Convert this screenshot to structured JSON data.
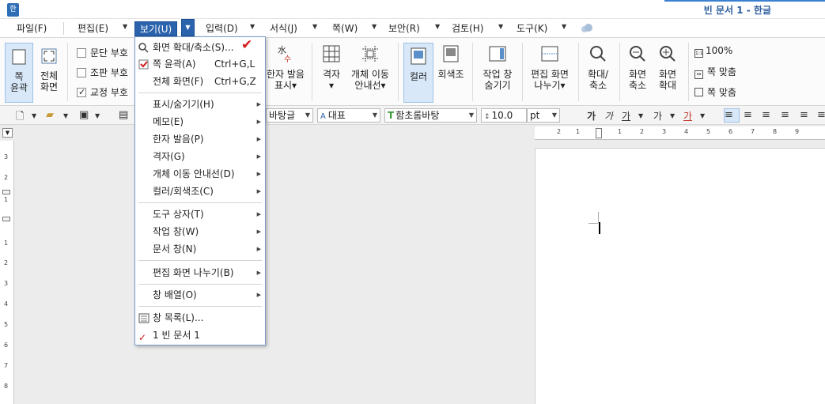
{
  "window": {
    "app_icon": "한",
    "title": "빈 문서 1 - 한글"
  },
  "menubar": {
    "items": [
      {
        "label": "파일(F)"
      },
      {
        "label": "편집(E)"
      },
      {
        "label": "보기(U)"
      },
      {
        "label": "입력(D)"
      },
      {
        "label": "서식(J)"
      },
      {
        "label": "쪽(W)"
      },
      {
        "label": "보안(R)"
      },
      {
        "label": "검토(H)"
      },
      {
        "label": "도구(K)"
      }
    ]
  },
  "ribbon": {
    "page_outline": "쪽\n윤곽",
    "full_screen": "전체\n화면",
    "checkboxes": [
      {
        "label": "문단 부호",
        "checked": false
      },
      {
        "label": "조판 부호",
        "checked": false
      },
      {
        "label": "교정 부호",
        "checked": true
      }
    ],
    "hanja_reading": "한자 발음\n표시▾",
    "grid": "격자\n▾",
    "object_guide": "개체 이동\n안내선▾",
    "color": "컬러",
    "grayscale": "회색조",
    "task_pane": "작업 창\n숨기기",
    "split_view": "편집 화면\n나누기▾",
    "zoom_dialog": "확대/\n축소",
    "zoom_out": "화면\n축소",
    "zoom_in": "화면\n확대",
    "zoom_100": "100%",
    "fit_width": "쪽 맞춤",
    "fit_page": "쪽 맞춤"
  },
  "format_toolbar": {
    "style": "바탕글",
    "font_lang": "대표",
    "font_name": "함초롬바탕",
    "font_size": "10.0",
    "size_unit": "pt"
  },
  "dropdown": {
    "items": [
      {
        "icon": "magnifier-icon",
        "label": "화면 확대/축소(S)..."
      },
      {
        "icon": "checkbox-icon",
        "label": "쪽 윤곽(A)",
        "shortcut": "Ctrl+G,L"
      },
      {
        "label": "전체 화면(F)",
        "shortcut": "Ctrl+G,Z"
      },
      {
        "label": "표시/숨기기(H)",
        "submenu": true
      },
      {
        "label": "메모(E)",
        "submenu": true
      },
      {
        "label": "한자 발음(P)",
        "submenu": true
      },
      {
        "label": "격자(G)",
        "submenu": true
      },
      {
        "label": "개체 이동 안내선(D)",
        "submenu": true
      },
      {
        "label": "컬러/회색조(C)",
        "submenu": true
      },
      {
        "label": "도구 상자(T)",
        "submenu": true
      },
      {
        "label": "작업 창(W)",
        "submenu": true
      },
      {
        "label": "문서 창(N)",
        "submenu": true
      },
      {
        "label": "편집 화면 나누기(B)",
        "submenu": true
      },
      {
        "label": "창 배열(O)",
        "submenu": true
      },
      {
        "icon": "window-list-icon",
        "label": "창 목록(L)..."
      },
      {
        "icon": "check-icon",
        "label": "1 빈 문서 1"
      }
    ]
  },
  "hruler": {
    "labels": [
      "2",
      "1",
      "1",
      "2",
      "3",
      "4",
      "5",
      "6",
      "7",
      "8",
      "9"
    ]
  },
  "vruler": {
    "labels": [
      "3",
      "2",
      "1",
      "1",
      "2",
      "3",
      "4",
      "5",
      "6",
      "7",
      "8"
    ]
  },
  "colors": {
    "active_menu": "#2b63ad",
    "title_text": "#2d5d9f",
    "red_check": "#d21a1a"
  }
}
